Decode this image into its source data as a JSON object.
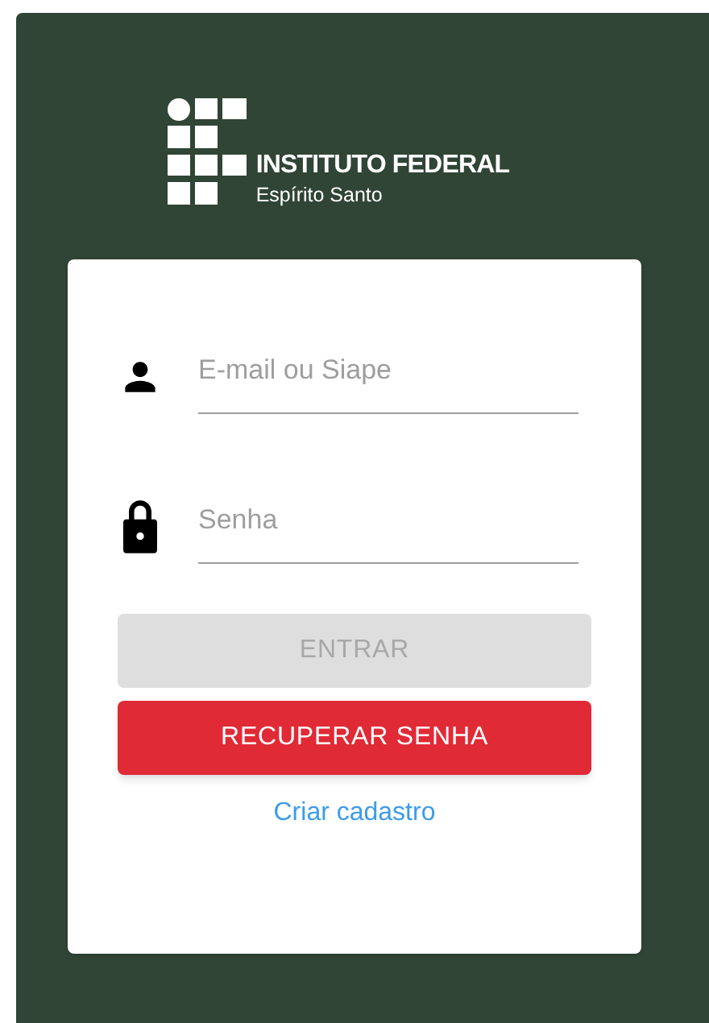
{
  "logo": {
    "title": "INSTITUTO FEDERAL",
    "subtitle": "Espírito Santo"
  },
  "fields": [
    {
      "kind": "user",
      "placeholder": "E-mail ou Siape"
    },
    {
      "kind": "password",
      "placeholder": "Senha"
    }
  ],
  "buttons": [
    {
      "label": "ENTRAR",
      "kind": "primary",
      "disabled": true
    },
    {
      "label": "RECUPERAR SENHA",
      "kind": "danger",
      "disabled": false
    }
  ],
  "link": "Criar cadastro"
}
